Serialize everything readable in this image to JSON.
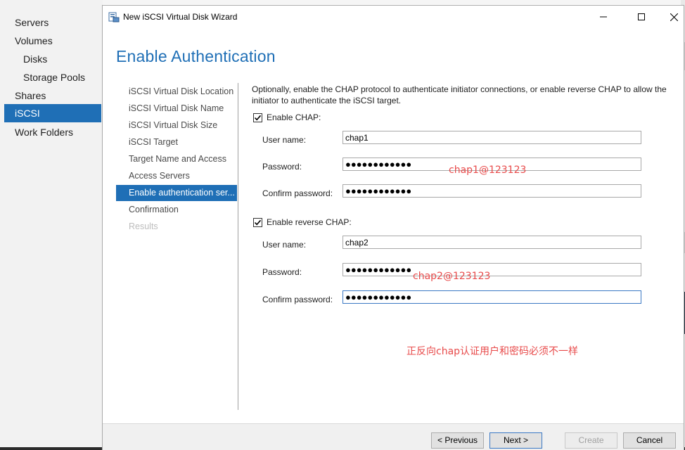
{
  "background_nav": {
    "items": [
      {
        "label": "Servers"
      },
      {
        "label": "Volumes"
      },
      {
        "label": "Disks"
      },
      {
        "label": "Storage Pools"
      },
      {
        "label": "Shares"
      },
      {
        "label": "iSCSI"
      },
      {
        "label": "Work Folders"
      }
    ],
    "active_item": "iSCSI"
  },
  "window": {
    "title": "New iSCSI Virtual Disk Wizard",
    "icon": "wizard-disk-icon",
    "controls": [
      "minimize-icon",
      "maximize-icon",
      "close-icon"
    ]
  },
  "page": {
    "heading": "Enable Authentication"
  },
  "steps": [
    {
      "label": "iSCSI Virtual Disk Location",
      "state": "normal"
    },
    {
      "label": "iSCSI Virtual Disk Name",
      "state": "normal"
    },
    {
      "label": "iSCSI Virtual Disk Size",
      "state": "normal"
    },
    {
      "label": "iSCSI Target",
      "state": "normal"
    },
    {
      "label": "Target Name and Access",
      "state": "normal"
    },
    {
      "label": "Access Servers",
      "state": "normal"
    },
    {
      "label": "Enable authentication ser...",
      "state": "active"
    },
    {
      "label": "Confirmation",
      "state": "normal"
    },
    {
      "label": "Results",
      "state": "disabled"
    }
  ],
  "content": {
    "intro_line1": "Optionally, enable the CHAP protocol to authenticate initiator connections, or enable reverse CHAP to allow the",
    "intro_line2": "initiator to authenticate the iSCSI target.",
    "chap": {
      "checkbox_label": "Enable CHAP:",
      "checked": true,
      "user_name_label": "User name:",
      "user_name_value": "chap1",
      "password_label": "Password:",
      "password_value": "●●●●●●●●●●●●",
      "confirm_label": "Confirm password:",
      "confirm_value": "●●●●●●●●●●●●"
    },
    "reverse_chap": {
      "checkbox_label": "Enable reverse CHAP:",
      "checked": true,
      "user_name_label": "User name:",
      "user_name_value": "chap2",
      "password_label": "Password:",
      "password_value": "●●●●●●●●●●●●",
      "confirm_label": "Confirm password:",
      "confirm_value": "●●●●●●●●●●●●"
    }
  },
  "annotations": {
    "chap_password": "chap1@123123",
    "reverse_password": "chap2@123123",
    "note": "正反向chap认证用户和密码必须不一样",
    "color": "#e84b4b"
  },
  "footer": {
    "previous_label": "< Previous",
    "next_label": "Next >",
    "create_label": "Create",
    "cancel_label": "Cancel"
  },
  "colors": {
    "accent": "#1f6fb6",
    "annotation": "#e84b4b"
  }
}
